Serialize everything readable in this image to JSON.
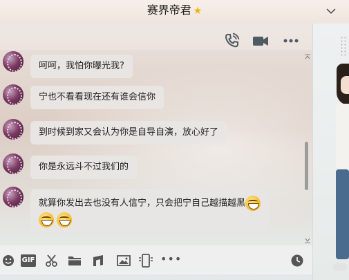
{
  "window": {
    "title": "赛界帝君",
    "title_star": "★"
  },
  "toolbar": [
    "voice-call",
    "video-call",
    "more"
  ],
  "messages": [
    {
      "text": "呵呵，我怕你曝光我?"
    },
    {
      "text": "宁也不看看现在还有谁会信你"
    },
    {
      "text": "到时候到家又会认为你是自导自演，放心好了"
    },
    {
      "text": "你是永远斗不过我们的"
    },
    {
      "text": "就算你发出去也没有人信宁，只会把宁自己越描越黑"
    }
  ],
  "input_toolbar": {
    "gif_label": "GIF",
    "more_label": "•••"
  },
  "colors": {
    "accent": "#f0b400",
    "bubble_bg": "#e8e6e4"
  }
}
